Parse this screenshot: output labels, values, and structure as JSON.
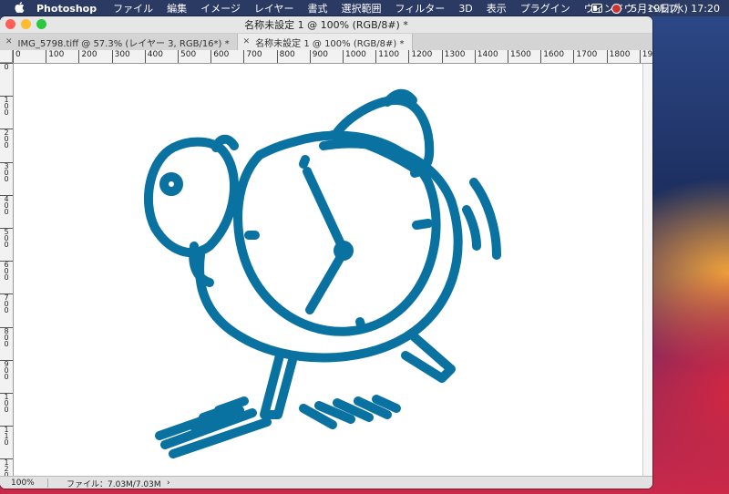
{
  "menubar": {
    "apple_icon": "",
    "app_name": "Photoshop",
    "items": [
      "ファイル",
      "編集",
      "イメージ",
      "レイヤー",
      "書式",
      "選択範囲",
      "フィルター",
      "3D",
      "表示",
      "プラグイン",
      "ウィンドウ",
      "ヘルプ"
    ],
    "datetime": "5月19日(水)  17:20"
  },
  "window": {
    "title": "名称未設定 1 @ 100% (RGB/8#) *",
    "tabs": [
      {
        "label": "IMG_5798.tiff @ 57.3% (レイヤー 3, RGB/16*) *",
        "active": false
      },
      {
        "label": "名称未設定 1 @ 100% (RGB/8#) *",
        "active": true
      }
    ]
  },
  "ruler": {
    "h_labels": [
      "0",
      "100",
      "200",
      "300",
      "400",
      "500",
      "600",
      "700",
      "800",
      "900",
      "1000",
      "1100",
      "1200",
      "1300",
      "1400",
      "1500",
      "1600",
      "1700",
      "1800",
      "19"
    ],
    "v_labels": [
      "0",
      "1\n0\n0",
      "2\n0\n0",
      "3\n0\n0",
      "4\n0\n0",
      "5\n0\n0",
      "6\n0\n0",
      "7\n0\n0",
      "8\n0\n0",
      "9\n0\n0",
      "1\n0\n0",
      "1\n1\n0",
      "1\n2\n0"
    ]
  },
  "status": {
    "zoom": "100%",
    "file_info": "ファイル：7.03M/7.03M",
    "arrow": "›"
  },
  "drawing": {
    "subject": "alarm-clock-doodle",
    "stroke_color": "#0a72a0"
  }
}
